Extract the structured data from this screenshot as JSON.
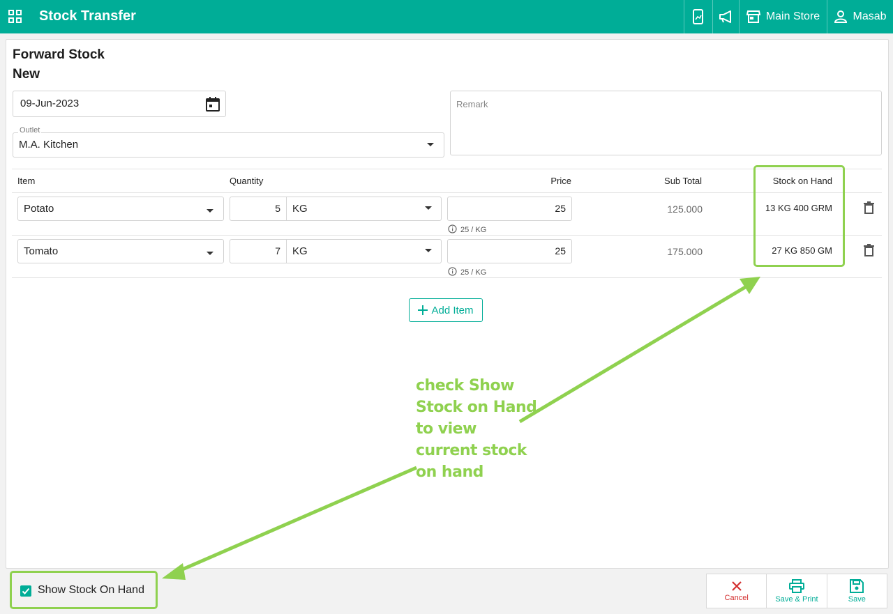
{
  "header": {
    "title": "Stock Transfer",
    "store": "Main Store",
    "user": "Masab"
  },
  "form": {
    "heading": "Forward Stock",
    "status": "New",
    "date": "09-Jun-2023",
    "outlet_label": "Outlet",
    "outlet_value": "M.A. Kitchen",
    "remark_placeholder": "Remark"
  },
  "table": {
    "headers": {
      "item": "Item",
      "quantity": "Quantity",
      "price": "Price",
      "sub_total": "Sub Total",
      "stock_on_hand": "Stock on Hand"
    },
    "rows": [
      {
        "item": "Potato",
        "qty": "5",
        "unit": "KG",
        "price": "25",
        "price_hint": "25 / KG",
        "sub_total": "125.000",
        "soh": "13 KG 400 GRM"
      },
      {
        "item": "Tomato",
        "qty": "7",
        "unit": "KG",
        "price": "25",
        "price_hint": "25 / KG",
        "sub_total": "175.000",
        "soh": "27 KG 850 GM"
      }
    ]
  },
  "add_item_label": "Add Item",
  "annotation": {
    "lines": [
      "check Show",
      "Stock on Hand",
      "to view",
      "current stock",
      "on hand"
    ]
  },
  "footer": {
    "checkbox_label": "Show Stock On Hand",
    "cancel": "Cancel",
    "save_print": "Save & Print",
    "save": "Save"
  },
  "colors": {
    "primary": "#00ad97",
    "annotation": "#8fd14f",
    "danger": "#d32f2f"
  },
  "icons": [
    "apps-icon",
    "device-icon",
    "megaphone-icon",
    "store-icon",
    "user-icon",
    "calendar-icon",
    "caret-down-icon",
    "info-icon",
    "trash-icon",
    "plus-icon",
    "close-icon",
    "print-icon",
    "save-icon",
    "checkbox-checked-icon"
  ]
}
